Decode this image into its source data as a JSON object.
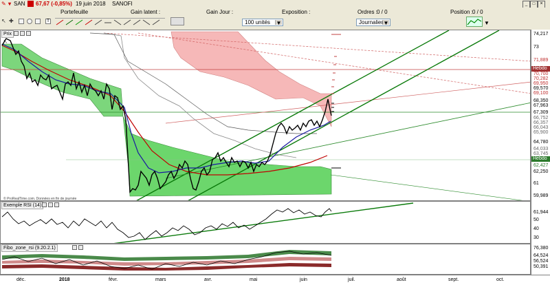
{
  "title": {
    "symbol": "SAN",
    "price": "67,67 (-0,85%)",
    "date": "19 juin 2018",
    "name": "SANOFI"
  },
  "toolbar": {
    "portefeuille": "Portefeuille",
    "gain_latent": "Gain latent :",
    "gain_jour": "Gain Jour :",
    "exposition": "Exposition :",
    "ordres": "Ordres :",
    "ordres_counts": "0 / 0",
    "position": "Position :",
    "position_counts": "0 / 0",
    "quantity_value": "100 unités",
    "period_value": "Journalier"
  },
  "panes": {
    "price": {
      "label": "Prix",
      "source": "© ProRealTime.com. Données en fin de journée"
    },
    "rsi": {
      "label": "Exemple RSI (14)"
    },
    "fibo": {
      "label": "Fibo_zone_rsi (9.20.2.1)"
    }
  },
  "price_axis": {
    "ticks": [
      "74,217",
      "73",
      "71,889",
      "Hebdo",
      "70,700",
      "70,282",
      "69,950",
      "69,570",
      "69,100",
      "68,350",
      "67,963",
      "67,309",
      "66,752",
      "66,357",
      "66,043",
      "65,900",
      "64,780",
      "64,033",
      "63,745",
      "Hebdo",
      "62,427",
      "62,250",
      "61",
      "59,989"
    ],
    "price_tag": "67,670"
  },
  "rsi_axis": {
    "ticks": [
      "61,944",
      "50",
      "40",
      "30"
    ]
  },
  "fibo_axis": {
    "ticks": [
      "76,380",
      "64,524",
      "56,524",
      "50,391"
    ]
  },
  "x_axis": {
    "ticks": [
      "déc.",
      "2018",
      "févr.",
      "mars",
      "avr.",
      "mai",
      "juin",
      "juil.",
      "août",
      "sept.",
      "oct."
    ]
  },
  "colors": {
    "price_line": "#000000",
    "ma_blue": "#1a1aa0",
    "ma_red": "#c00000",
    "cloud_green": "#4cc94c",
    "cloud_red": "#f2a0a0",
    "trend_green": "#0a7a0a",
    "hebdo": "#a03030"
  }
}
